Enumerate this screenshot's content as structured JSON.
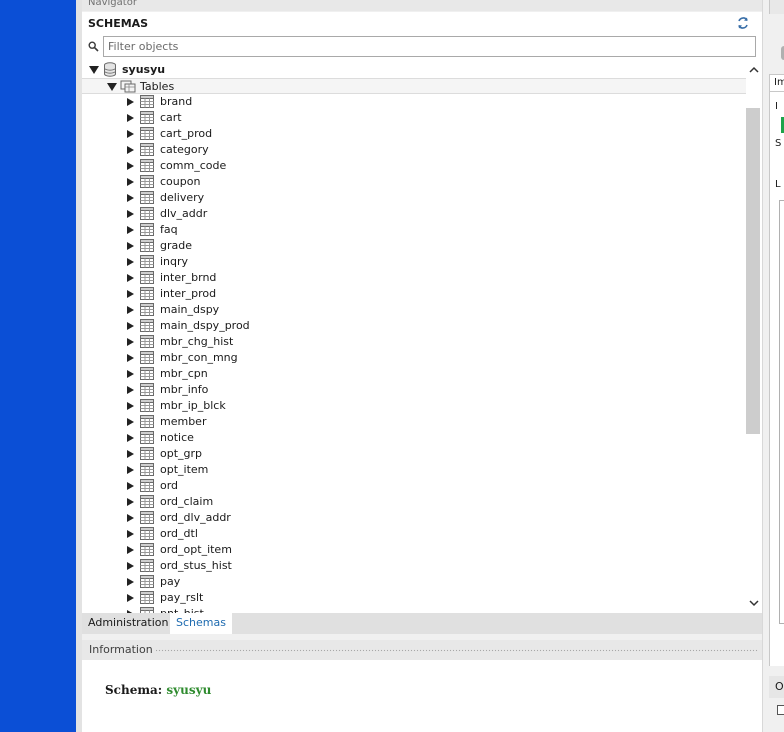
{
  "navigator": {
    "title": "Navigator"
  },
  "schemas": {
    "title": "SCHEMAS",
    "filter_placeholder": "Filter objects"
  },
  "tree": {
    "schema_name": "syusyu",
    "tables_label": "Tables",
    "tables": [
      "brand",
      "cart",
      "cart_prod",
      "category",
      "comm_code",
      "coupon",
      "delivery",
      "dlv_addr",
      "faq",
      "grade",
      "inqry",
      "inter_brnd",
      "inter_prod",
      "main_dspy",
      "main_dspy_prod",
      "mbr_chg_hist",
      "mbr_con_mng",
      "mbr_cpn",
      "mbr_info",
      "mbr_ip_blck",
      "member",
      "notice",
      "opt_grp",
      "opt_item",
      "ord",
      "ord_claim",
      "ord_dlv_addr",
      "ord_dtl",
      "ord_opt_item",
      "ord_stus_hist",
      "pay",
      "pay_rslt",
      "pnt_hist"
    ]
  },
  "tabs": [
    {
      "label": "Administration",
      "active": false
    },
    {
      "label": "Schemas",
      "active": true
    }
  ],
  "information": {
    "title": "Information",
    "schema_label": "Schema:",
    "schema_value": "syusyu"
  },
  "right_panel": {
    "tab_label": "Im",
    "bottom_tab_label": "O",
    "letters": [
      "I",
      "S",
      "L"
    ]
  },
  "colors": {
    "desktop_blue": "#0b4fd6",
    "schema_green": "#2e8b2e",
    "active_tab_text": "#1e6bb0",
    "status_green": "#1da34a"
  }
}
